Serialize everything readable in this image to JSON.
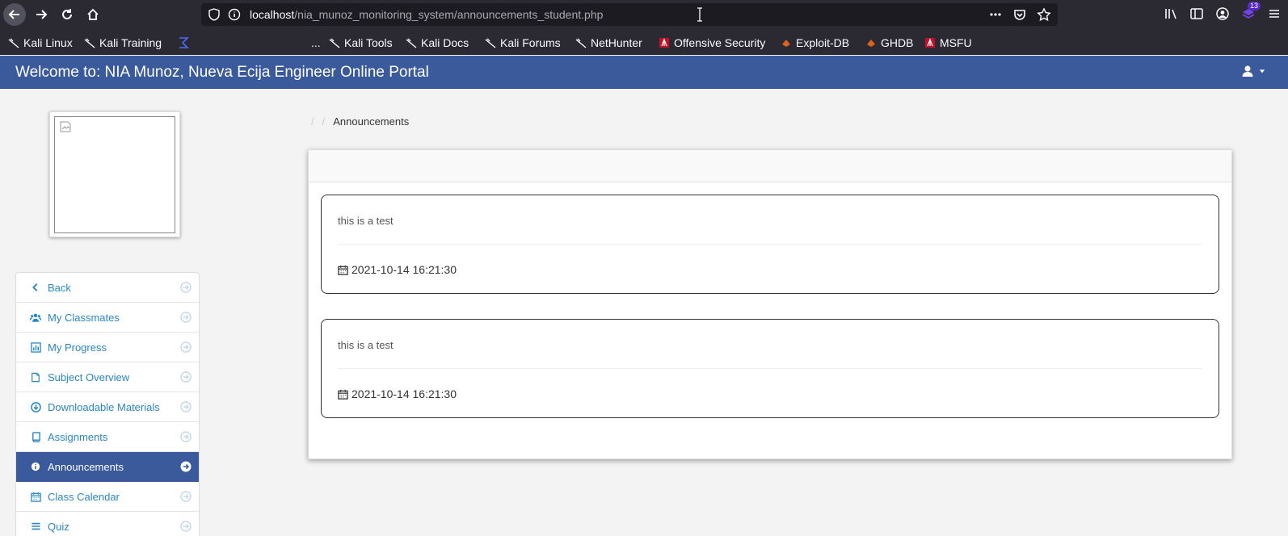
{
  "browser": {
    "url_host": "localhost",
    "url_path": "/nia_munoz_monitoring_system/announcements_student.php",
    "badge_count": "13",
    "bookmarks": [
      {
        "label": "Kali Linux",
        "icon": "kali-dragon-icon"
      },
      {
        "label": "Kali Training",
        "icon": "kali-dragon-icon"
      },
      {
        "label": "",
        "icon": "sigma-icon"
      },
      {
        "label": "...",
        "icon": ""
      },
      {
        "label": "Kali Tools",
        "icon": "kali-dragon-icon"
      },
      {
        "label": "Kali Docs",
        "icon": "kali-dragon-icon"
      },
      {
        "label": "Kali Forums",
        "icon": "kali-dragon-icon"
      },
      {
        "label": "NetHunter",
        "icon": "kali-dragon-icon"
      },
      {
        "label": "Offensive Security",
        "icon": "offsec-icon"
      },
      {
        "label": "Exploit-DB",
        "icon": "exploitdb-icon"
      },
      {
        "label": "GHDB",
        "icon": "exploitdb-icon"
      },
      {
        "label": "MSFU",
        "icon": "offsec-icon"
      }
    ]
  },
  "header": {
    "title": "Welcome to: NIA Munoz, Nueva Ecija Engineer Online Portal"
  },
  "sidebar": {
    "items": [
      {
        "label": "Back",
        "icon": "chevron-left-icon",
        "active": false
      },
      {
        "label": "My Classmates",
        "icon": "users-icon",
        "active": false
      },
      {
        "label": "My Progress",
        "icon": "bar-chart-icon",
        "active": false
      },
      {
        "label": "Subject Overview",
        "icon": "file-icon",
        "active": false
      },
      {
        "label": "Downloadable Materials",
        "icon": "download-icon",
        "active": false
      },
      {
        "label": "Assignments",
        "icon": "book-icon",
        "active": false
      },
      {
        "label": "Announcements",
        "icon": "info-icon",
        "active": true
      },
      {
        "label": "Class Calendar",
        "icon": "calendar-icon",
        "active": false
      },
      {
        "label": "Quiz",
        "icon": "list-icon",
        "active": false
      }
    ]
  },
  "breadcrumb": {
    "current": "Announcements"
  },
  "announcements": [
    {
      "message": "this is a test",
      "date": "2021-10-14 16:21:30"
    },
    {
      "message": "this is a test",
      "date": "2021-10-14 16:21:30"
    }
  ],
  "colors": {
    "header_bg": "#3a5a9b",
    "link": "#2a87c5",
    "chrome_bg": "#2b2a33"
  }
}
